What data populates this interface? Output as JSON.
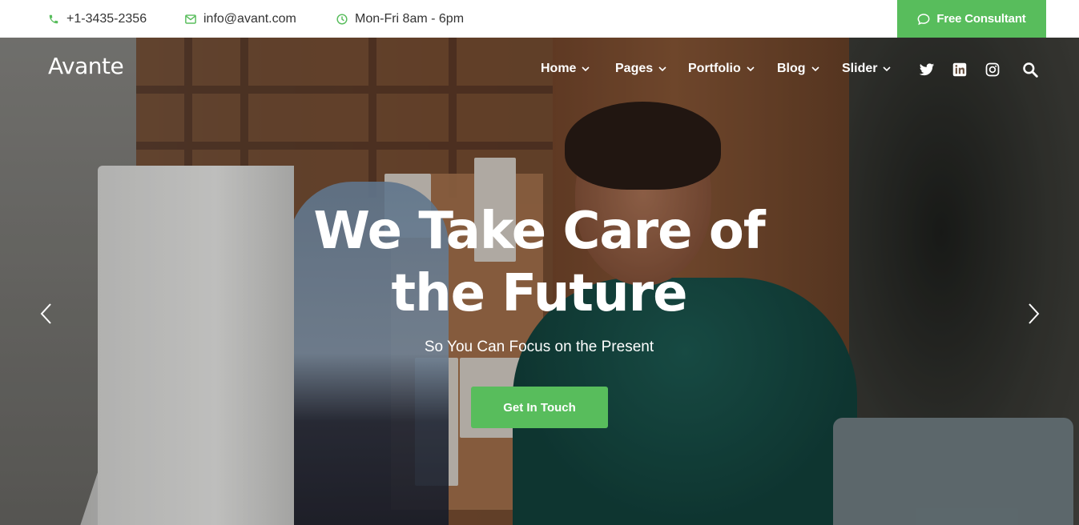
{
  "topbar": {
    "phone": "+1-3435-2356",
    "email": "info@avant.com",
    "hours": "Mon-Fri 8am - 6pm",
    "cta_label": "Free Consultant",
    "icons": [
      "phone-icon",
      "envelope-icon",
      "clock-icon",
      "chat-bubble-icon"
    ]
  },
  "brand": {
    "logo": "Avante"
  },
  "nav": {
    "items": [
      {
        "label": "Home"
      },
      {
        "label": "Pages"
      },
      {
        "label": "Portfolio"
      },
      {
        "label": "Blog"
      },
      {
        "label": "Slider"
      }
    ],
    "social_icons": [
      "twitter-icon",
      "linkedin-icon",
      "instagram-icon",
      "search-icon"
    ]
  },
  "hero": {
    "title_line1": "We Take Care of",
    "title_line2": "the Future",
    "subtitle": "So You Can Focus on the Present",
    "cta_label": "Get In Touch",
    "arrows": [
      "chevron-left-icon",
      "chevron-right-icon"
    ]
  },
  "colors": {
    "accent": "#58bd5c",
    "text_dark": "#333333",
    "white": "#ffffff"
  }
}
